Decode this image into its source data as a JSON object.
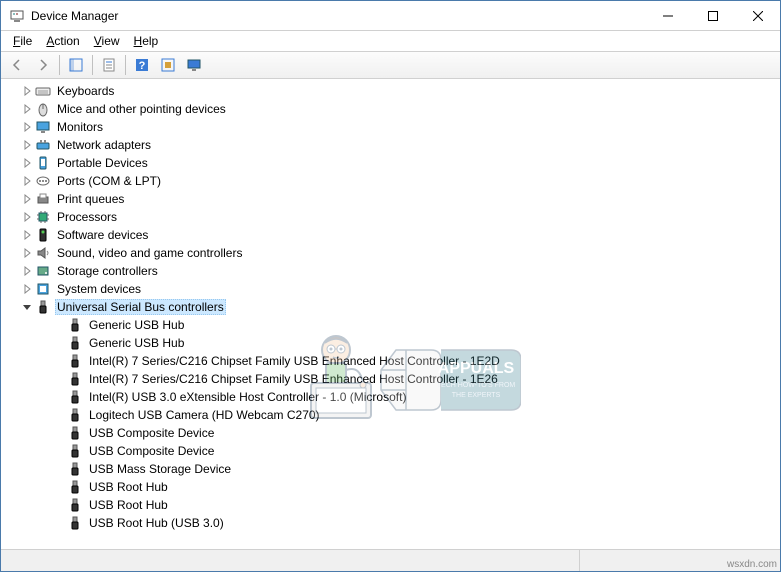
{
  "window": {
    "title": "Device Manager"
  },
  "menubar": {
    "file": "File",
    "action": "Action",
    "view": "View",
    "help": "Help"
  },
  "tree": {
    "categories": [
      {
        "icon": "keyboard",
        "label": "Keyboards",
        "expanded": false
      },
      {
        "icon": "mouse",
        "label": "Mice and other pointing devices",
        "expanded": false
      },
      {
        "icon": "monitor",
        "label": "Monitors",
        "expanded": false
      },
      {
        "icon": "network",
        "label": "Network adapters",
        "expanded": false
      },
      {
        "icon": "portable",
        "label": "Portable Devices",
        "expanded": false
      },
      {
        "icon": "port",
        "label": "Ports (COM & LPT)",
        "expanded": false
      },
      {
        "icon": "printq",
        "label": "Print queues",
        "expanded": false
      },
      {
        "icon": "cpu",
        "label": "Processors",
        "expanded": false
      },
      {
        "icon": "software",
        "label": "Software devices",
        "expanded": false
      },
      {
        "icon": "sound",
        "label": "Sound, video and game controllers",
        "expanded": false
      },
      {
        "icon": "storage",
        "label": "Storage controllers",
        "expanded": false
      },
      {
        "icon": "system",
        "label": "System devices",
        "expanded": false
      },
      {
        "icon": "usb",
        "label": "Universal Serial Bus controllers",
        "expanded": true,
        "selected": true,
        "children": [
          {
            "label": "Generic USB Hub"
          },
          {
            "label": "Generic USB Hub"
          },
          {
            "label": "Intel(R) 7 Series/C216 Chipset Family USB Enhanced Host Controller - 1E2D"
          },
          {
            "label": "Intel(R) 7 Series/C216 Chipset Family USB Enhanced Host Controller - 1E26"
          },
          {
            "label": "Intel(R) USB 3.0 eXtensible Host Controller - 1.0 (Microsoft)"
          },
          {
            "label": "Logitech USB Camera (HD Webcam C270)"
          },
          {
            "label": "USB Composite Device"
          },
          {
            "label": "USB Composite Device"
          },
          {
            "label": "USB Mass Storage Device"
          },
          {
            "label": "USB Root Hub"
          },
          {
            "label": "USB Root Hub"
          },
          {
            "label": "USB Root Hub (USB 3.0)"
          }
        ]
      }
    ]
  },
  "watermark": {
    "brand": "APPUALS",
    "tagline1": "TECH HOW-TO'S FROM",
    "tagline2": "THE EXPERTS"
  },
  "credit": "wsxdn.com"
}
